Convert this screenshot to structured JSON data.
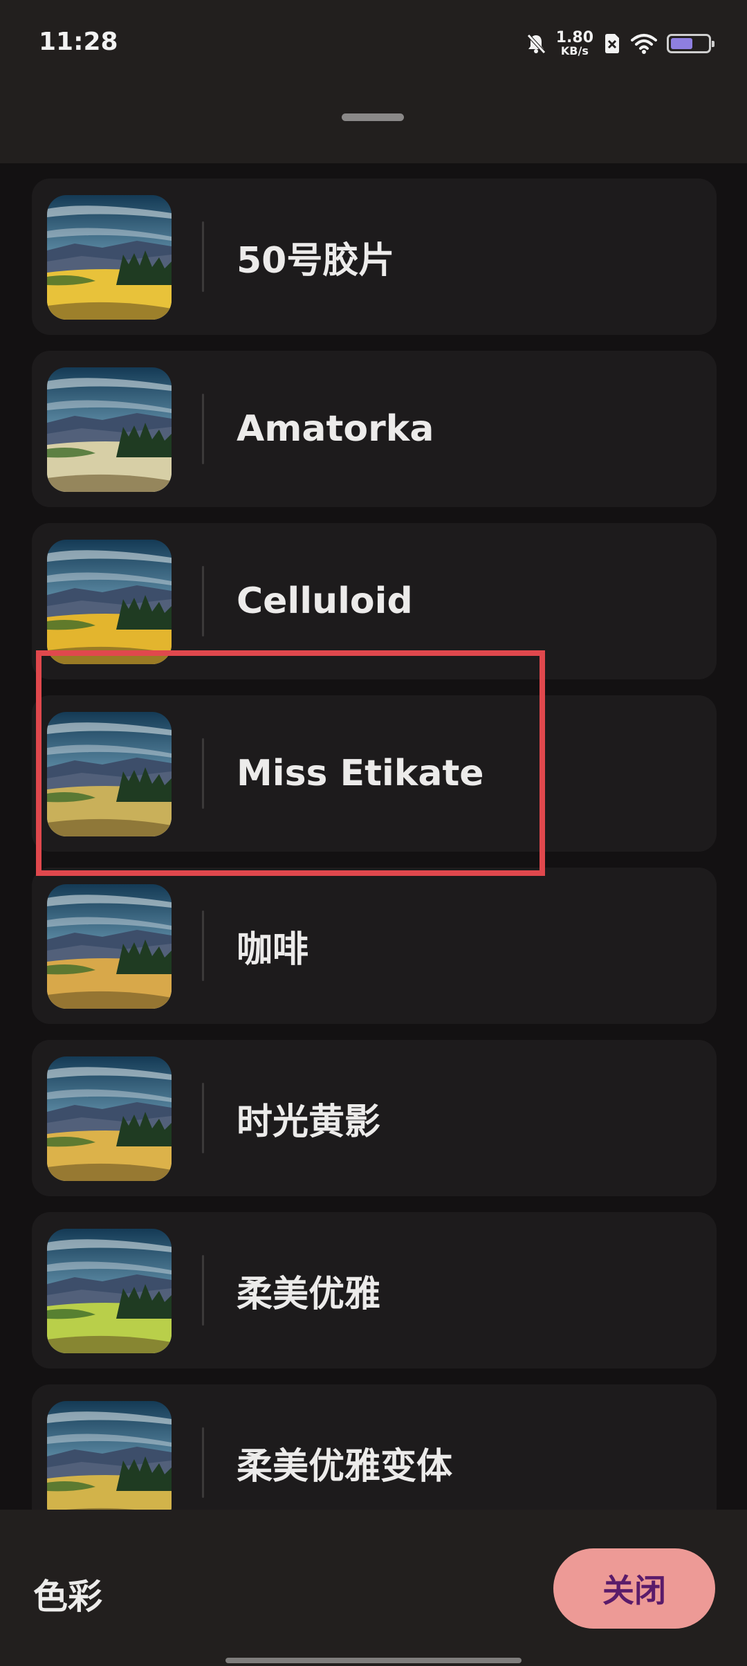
{
  "status_bar": {
    "time": "11:28",
    "net_speed_value": "1.80",
    "net_speed_unit": "KB/s",
    "icons": [
      "bell-muted-icon",
      "sim-off-icon",
      "wifi-icon",
      "battery-icon"
    ],
    "battery_level": 0.6
  },
  "filters": [
    {
      "label": "50号胶片",
      "tint": "#e8c23a"
    },
    {
      "label": "Amatorka",
      "tint": "#d7cfa6"
    },
    {
      "label": "Celluloid",
      "tint": "#e3b52e"
    },
    {
      "label": "Miss Etikate",
      "tint": "#c9b05a"
    },
    {
      "label": "咖啡",
      "tint": "#d8a84a"
    },
    {
      "label": "时光黄影",
      "tint": "#dcb24a"
    },
    {
      "label": "柔美优雅",
      "tint": "#b9cf4a"
    },
    {
      "label": "柔美优雅变体",
      "tint": "#d2b34a"
    }
  ],
  "highlighted_item": "Miss Etikate",
  "bottom": {
    "section_title": "色彩",
    "close_label": "关闭"
  },
  "colors": {
    "accent_button": "#ed9a96",
    "highlight_border": "#e0484d"
  }
}
